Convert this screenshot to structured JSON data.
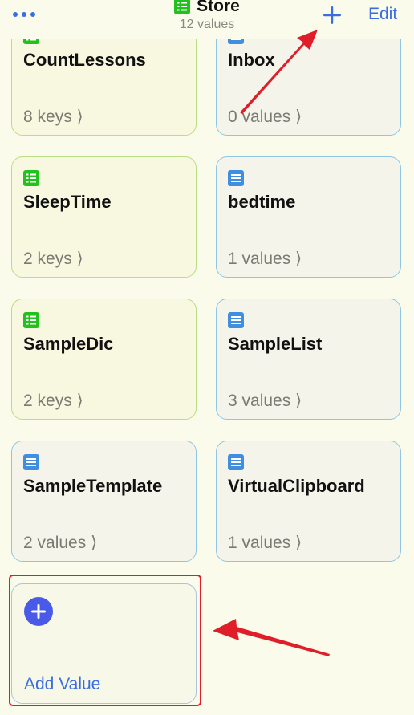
{
  "navbar": {
    "title": "Store",
    "subtitle": "12 values",
    "edit_label": "Edit",
    "more_icon": "ellipsis-icon",
    "add_icon": "plus-icon"
  },
  "cards": [
    {
      "name": "CountLessons",
      "count": "8 keys ⟩",
      "kind": "dictionary"
    },
    {
      "name": "Inbox",
      "count": "0 values ⟩",
      "kind": "list"
    },
    {
      "name": "SleepTime",
      "count": "2 keys ⟩",
      "kind": "dictionary"
    },
    {
      "name": "bedtime",
      "count": "1 values ⟩",
      "kind": "list"
    },
    {
      "name": "SampleDic",
      "count": "2 keys ⟩",
      "kind": "dictionary"
    },
    {
      "name": "SampleList",
      "count": "3 values ⟩",
      "kind": "list"
    },
    {
      "name": "SampleTemplate",
      "count": "2 values ⟩",
      "kind": "list"
    },
    {
      "name": "VirtualClipboard",
      "count": "1 values ⟩",
      "kind": "list"
    }
  ],
  "add_card": {
    "label": "Add Value",
    "icon": "plus-circle-icon"
  },
  "colors": {
    "background": "#fbfbeb",
    "accent_blue": "#3a6ee0",
    "dictionary_green": "#22c21e",
    "list_blue": "#3f8ee0",
    "annotation_red": "#e01e2a",
    "add_circle": "#4a5ae8"
  }
}
